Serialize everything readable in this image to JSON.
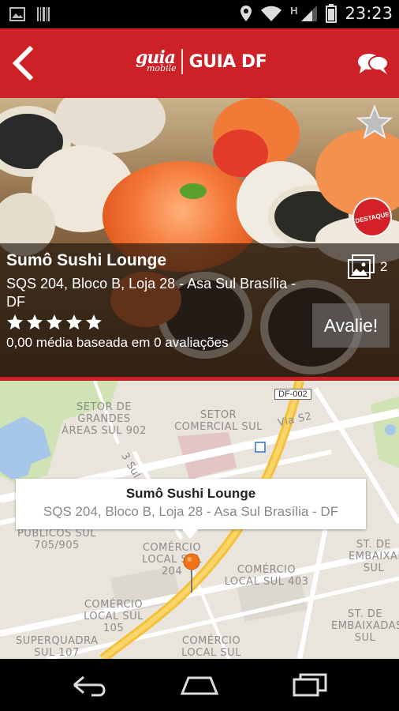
{
  "status_bar": {
    "time": "23:23",
    "network_letter": "H",
    "icons": [
      "image-icon",
      "barcode-icon",
      "location-icon",
      "wifi-icon",
      "signal-icon",
      "battery-icon"
    ]
  },
  "app_bar": {
    "logo_main": "guia",
    "logo_sub": "mobile",
    "city": "GUIA DF",
    "background": "#cc2127"
  },
  "place": {
    "name": "Sumô Sushi Lounge",
    "address": "SQS 204, Bloco B, Loja 28 - Asa Sul Brasília - DF",
    "stars": 5,
    "rating_text": "0,00 média baseada em 0 avaliações",
    "photos_count": "2",
    "rate_button": "Avalie!",
    "badge": "DESTAQUE"
  },
  "map": {
    "labels": [
      "SETOR DE GRANDES ÁREAS SUL 902",
      "SETOR COMERCIAL SUL",
      "PÚBLICOS SUL 705/905",
      "COMÉRCIO LOCAL SUL 204",
      "COMÉRCIO LOCAL SUL 403",
      "COMÉRCIO LOCAL SUL 105",
      "COMÉRCIO LOCAL SUL",
      "ST. DE EMBAIXADAS SUL",
      "ST. DE EMBAIXADAS SUL",
      "SUPERQUADRA SUL 107"
    ],
    "roads": [
      "DF-002",
      "Via S2",
      "3 Sul"
    ],
    "info_title": "Sumô Sushi Lounge",
    "info_address": "SQS 204, Bloco B, Loja 28 - Asa Sul Brasília - DF"
  },
  "nav_bar": {
    "buttons": [
      "back-icon",
      "home-icon",
      "recent-apps-icon"
    ]
  }
}
